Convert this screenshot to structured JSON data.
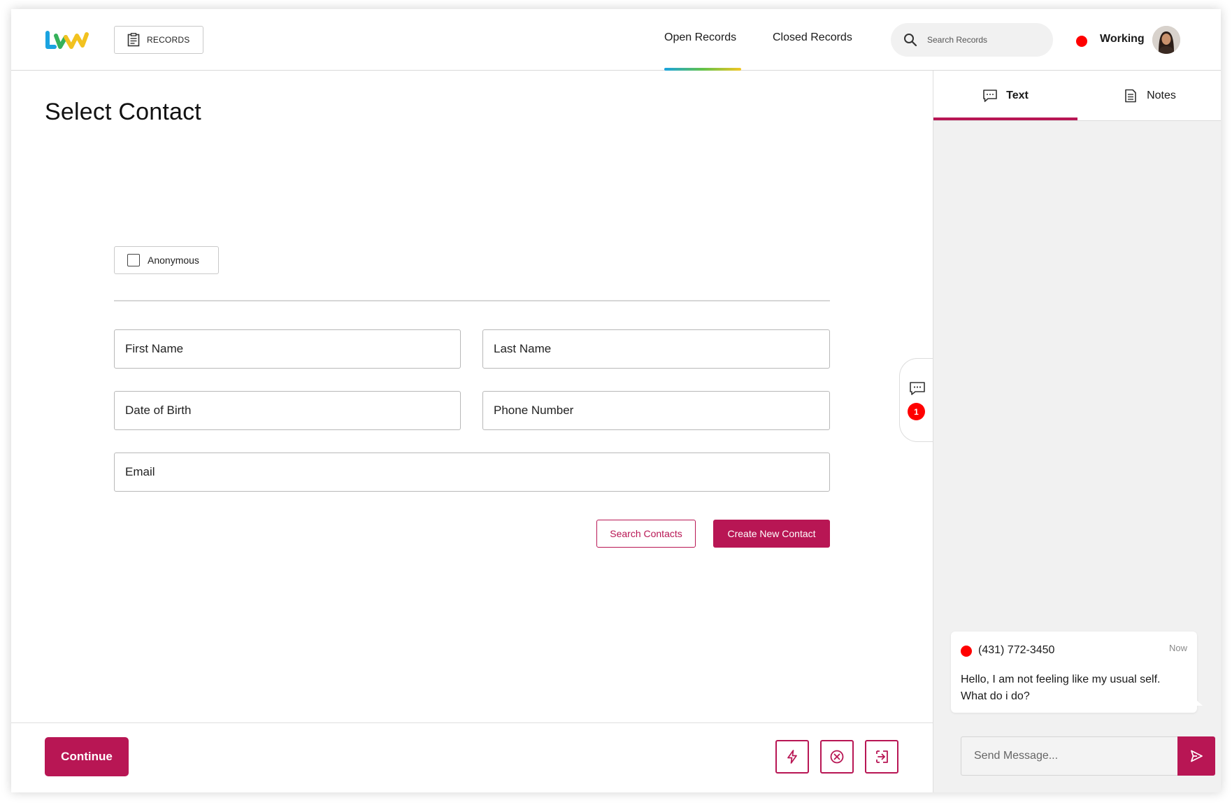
{
  "header": {
    "records_label": "RECORDS",
    "tabs": [
      {
        "label": "Open Records",
        "active": true
      },
      {
        "label": "Closed Records",
        "active": false
      }
    ],
    "search_placeholder": "Search Records",
    "status": {
      "label": "Working",
      "color": "#ff0000"
    }
  },
  "main": {
    "title": "Select Contact",
    "anonymous_label": "Anonymous",
    "anonymous_checked": false,
    "fields": {
      "first_name": "First Name",
      "last_name": "Last Name",
      "dob": "Date of Birth",
      "phone": "Phone Number",
      "email": "Email"
    },
    "search_contacts_label": "Search Contacts",
    "create_contact_label": "Create New Contact"
  },
  "chat_handle": {
    "unread_count": "1"
  },
  "footer": {
    "continue_label": "Continue",
    "icons": [
      "lightning-icon",
      "close-circle-icon",
      "exit-icon"
    ]
  },
  "panel": {
    "tabs": [
      {
        "label": "Text",
        "icon": "chat-icon",
        "active": true
      },
      {
        "label": "Notes",
        "icon": "document-icon",
        "active": false
      }
    ],
    "message": {
      "phone": "(431) 772-3450",
      "time": "Now",
      "body": "Hello, I am not feeling like my usual self. What do i do?"
    },
    "send_placeholder": "Send Message..."
  },
  "colors": {
    "accent": "#b81654",
    "status_red": "#ff0000",
    "panel_bg": "#f1f1f1"
  }
}
